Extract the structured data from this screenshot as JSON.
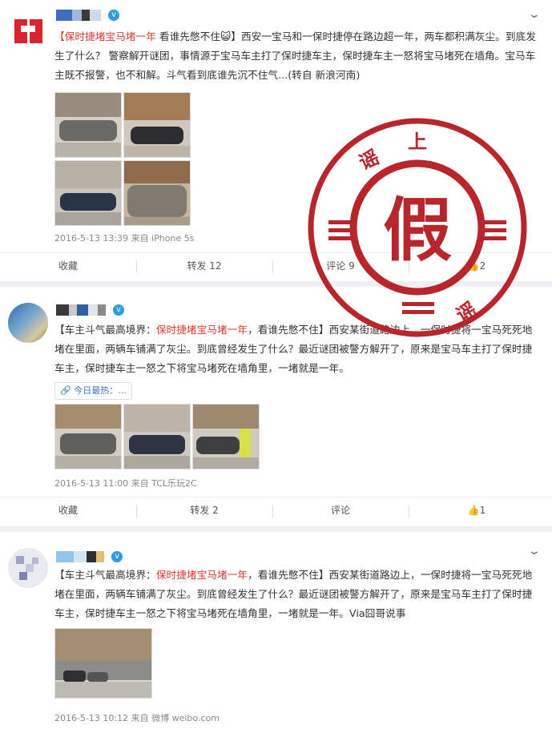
{
  "posts": [
    {
      "tag": "【保时捷堵宝马堵一年",
      "text": " 看谁先憋不住😺】西安一宝马和一保时捷停在路边超一年，两车都积满灰尘。到底发生了什么？ 警察解开谜团，事情源于宝马车主打了保时捷车主，保时捷车主一怒将宝马堵死在墙角。宝马车主既不报警，也不和解。斗气看到底谁先沉不住气...(转自 新浪河南)",
      "meta": "2016-5-13 13:39 来自 iPhone 5s",
      "actions": [
        "收藏",
        "转发 12",
        "评论 9",
        "👍2"
      ]
    },
    {
      "prefix": "【车主斗气最高境界：",
      "tag": "保时捷堵宝马堵一年",
      "text": "，看谁先憋不住】西安某街道路边上，一保时捷将一宝马死死地堵在里面，两辆车铺满了灰尘。到底曾经发生了什么？最近谜团被警方解开了，原来是宝马车主打了保时捷车主，保时捷车主一怒之下将宝马堵死在墙角里，一堵就是一年。",
      "topic": "今日最热：...",
      "meta": "2016-5-13 11:00 来自 TCL乐玩2C",
      "actions": [
        "收藏",
        "转发 2",
        "评论",
        "👍1"
      ]
    },
    {
      "prefix": "【车主斗气最高境界：",
      "tag": "保时捷堵宝马堵一年",
      "text": "，看谁先憋不住】西安某街道路边上，一保时捷将一宝马死死地堵在里面，两辆车铺满了灰尘。到底曾经发生了什么？最近谜团被警方解开了，原来是宝马车主打了保时捷车主，保时捷车主一怒之下将宝马堵死在墙角里，一堵就是一年。Via囧哥说事",
      "meta": "2016-5-13 10:12 来自 微博 weibo.com"
    }
  ],
  "stamp": {
    "center": "假",
    "ring_chars": [
      "谣",
      "上",
      "谣"
    ],
    "color": "#b8262c"
  },
  "icons": {
    "verified": "verified-icon",
    "chevron": "chevron-down-icon",
    "topic": "link-icon",
    "like": "thumb-up-icon"
  }
}
